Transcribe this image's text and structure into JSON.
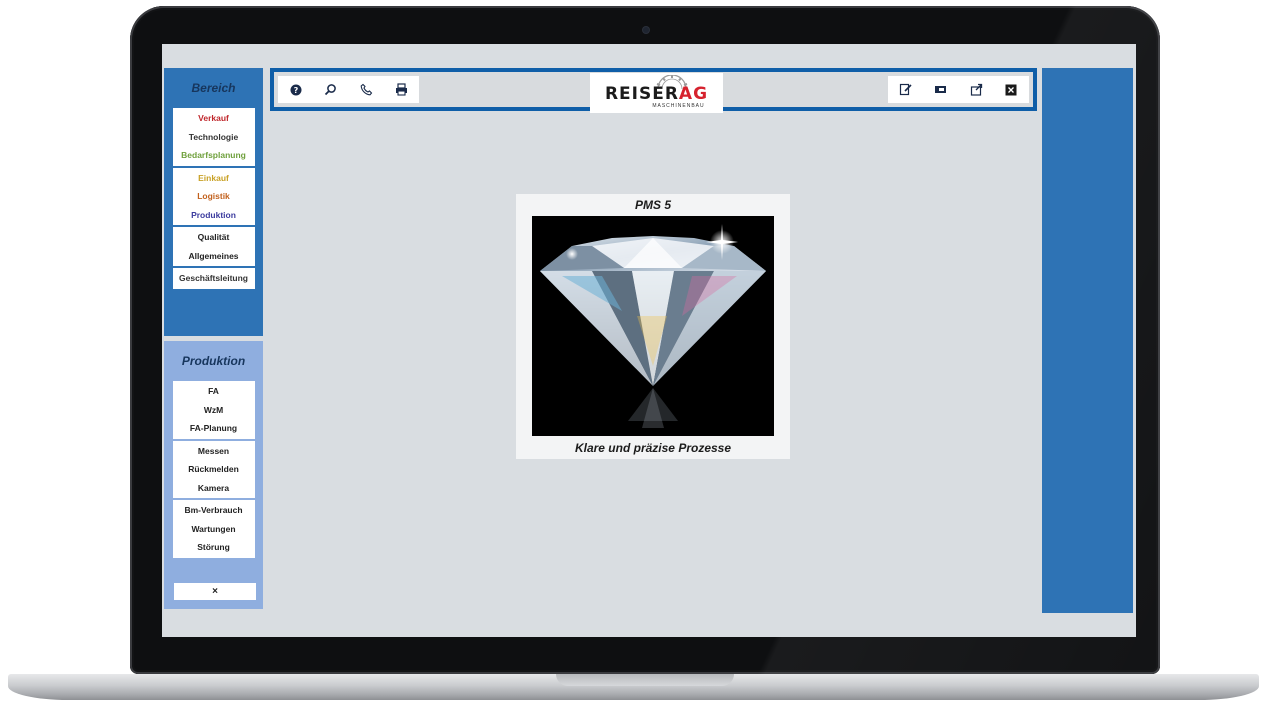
{
  "bereich": {
    "title": "Bereich",
    "groups": [
      [
        {
          "label": "Verkauf",
          "color": "#c0282d"
        },
        {
          "label": "Technologie",
          "color": "#333333"
        },
        {
          "label": "Bedarfsplanung",
          "color": "#6fa03c"
        }
      ],
      [
        {
          "label": "Einkauf",
          "color": "#c9a227"
        },
        {
          "label": "Logistik",
          "color": "#c2611d"
        },
        {
          "label": "Produktion",
          "color": "#3b3b9e"
        }
      ],
      [
        {
          "label": "Qualität",
          "color": "#222222"
        },
        {
          "label": "Allgemeines",
          "color": "#222222"
        }
      ],
      [
        {
          "label": "Geschäftsleitung",
          "color": "#333333"
        }
      ]
    ]
  },
  "produktion": {
    "title": "Produktion",
    "groups": [
      [
        {
          "label": "FA",
          "color": "#222222"
        },
        {
          "label": "WzM",
          "color": "#222222"
        },
        {
          "label": "FA-Planung",
          "color": "#222222"
        }
      ],
      [
        {
          "label": "Messen",
          "color": "#222222"
        },
        {
          "label": "Rückmelden",
          "color": "#222222"
        },
        {
          "label": "Kamera",
          "color": "#222222"
        }
      ],
      [
        {
          "label": "Bm-Verbrauch",
          "color": "#222222"
        },
        {
          "label": "Wartungen",
          "color": "#222222"
        },
        {
          "label": "Störung",
          "color": "#222222"
        }
      ]
    ],
    "close_label": "×"
  },
  "toolbar": {
    "left_icons": [
      "help-icon",
      "search-icon",
      "phone-icon",
      "print-icon"
    ],
    "right_icons": [
      "edit-icon",
      "window-icon",
      "export-icon",
      "close-icon"
    ],
    "logo": {
      "main_a": "REISER",
      "main_b": "AG",
      "sub": "MASCHINENBAU"
    }
  },
  "card": {
    "title": "PMS 5",
    "caption": "Klare und präzise Prozesse",
    "image": "diamond-image"
  },
  "colors": {
    "primary_blue": "#2e73b5",
    "toolbar_blue": "#0f5ea8",
    "light_blue": "#8faedf",
    "screen_bg": "#d9dde1",
    "logo_red": "#d6222e"
  }
}
